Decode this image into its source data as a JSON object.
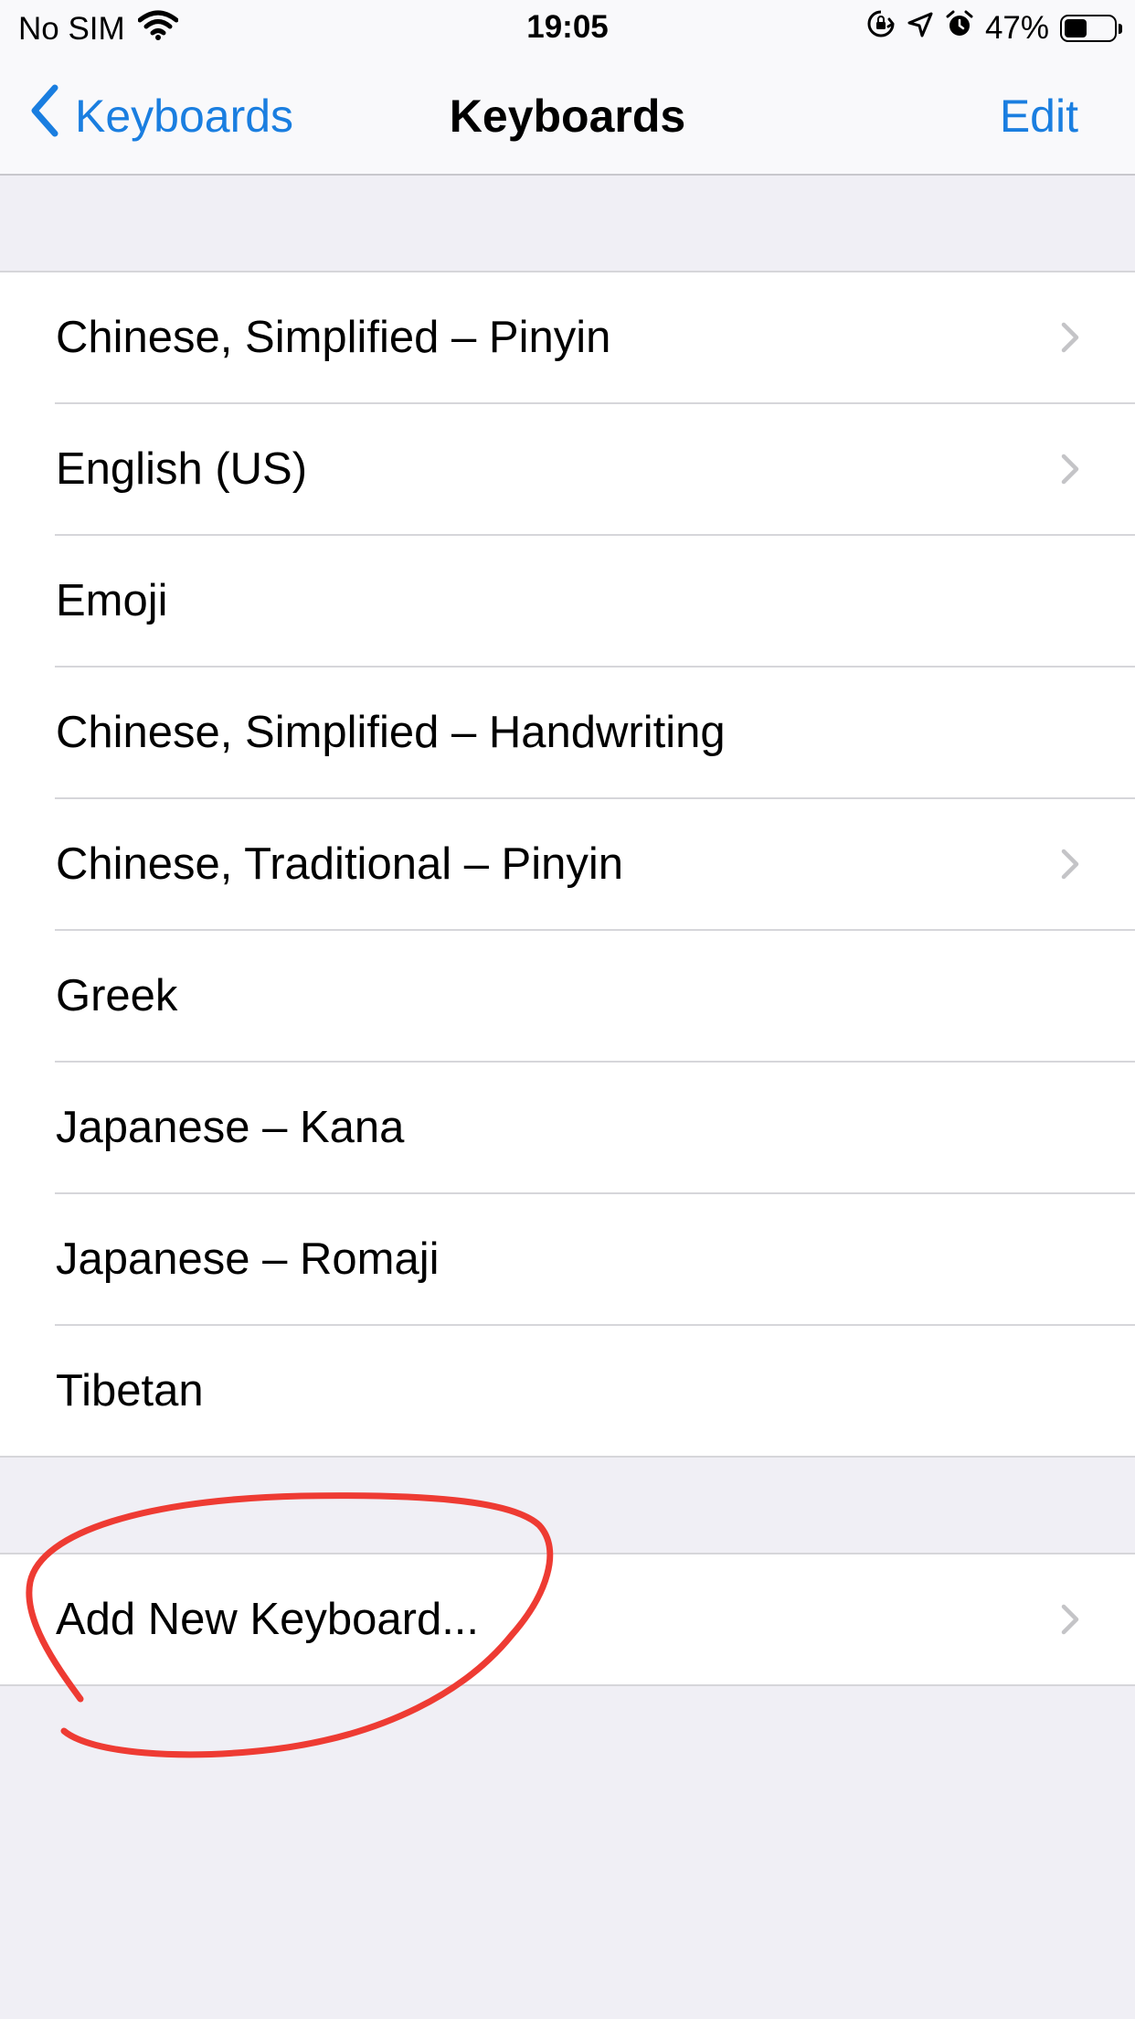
{
  "status_bar": {
    "carrier": "No SIM",
    "time": "19:05",
    "battery": "47%",
    "battery_level": 0.47
  },
  "nav": {
    "back_label": "Keyboards",
    "title": "Keyboards",
    "edit_label": "Edit"
  },
  "keyboards": [
    {
      "label": "Chinese, Simplified – Pinyin",
      "has_chevron": true
    },
    {
      "label": "English (US)",
      "has_chevron": true
    },
    {
      "label": "Emoji",
      "has_chevron": false
    },
    {
      "label": "Chinese, Simplified – Handwriting",
      "has_chevron": false
    },
    {
      "label": "Chinese, Traditional – Pinyin",
      "has_chevron": true
    },
    {
      "label": "Greek",
      "has_chevron": false
    },
    {
      "label": "Japanese – Kana",
      "has_chevron": false
    },
    {
      "label": "Japanese – Romaji",
      "has_chevron": false
    },
    {
      "label": "Tibetan",
      "has_chevron": false
    }
  ],
  "add_keyboard": {
    "label": "Add New Keyboard..."
  },
  "colors": {
    "accent": "#1a7ee0",
    "annotation": "#ee3b33",
    "background": "#f0eff5"
  }
}
